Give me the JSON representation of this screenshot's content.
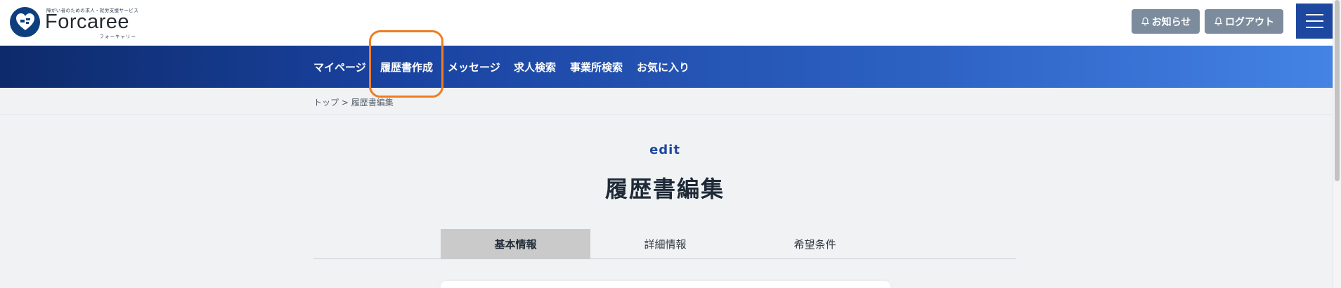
{
  "header": {
    "logo": {
      "tagline": "障がい者のための求人・就労支援サービス",
      "wordmark": "Forcaree",
      "kana": "フォーキャリー"
    },
    "notice_label": "お知らせ",
    "logout_label": "ログアウト",
    "menu_icon": "hamburger-icon",
    "bell_icon": "bell-icon"
  },
  "nav": {
    "items": [
      {
        "label": "マイページ"
      },
      {
        "label": "履歴書作成"
      },
      {
        "label": "メッセージ"
      },
      {
        "label": "求人検索"
      },
      {
        "label": "事業所検索"
      },
      {
        "label": "お気に入り"
      }
    ]
  },
  "breadcrumb": {
    "home": "トップ",
    "separator": ">",
    "current": "履歴書編集"
  },
  "page": {
    "subtitle": "edit",
    "title": "履歴書編集"
  },
  "tabs": [
    {
      "label": "基本情報",
      "active": true
    },
    {
      "label": "詳細情報",
      "active": false
    },
    {
      "label": "希望条件",
      "active": false
    }
  ],
  "colors": {
    "brand_navy": "#1e48a0",
    "highlight": "#f07d22",
    "button_grey": "#7c8c9d",
    "active_tab": "#cacaca"
  }
}
